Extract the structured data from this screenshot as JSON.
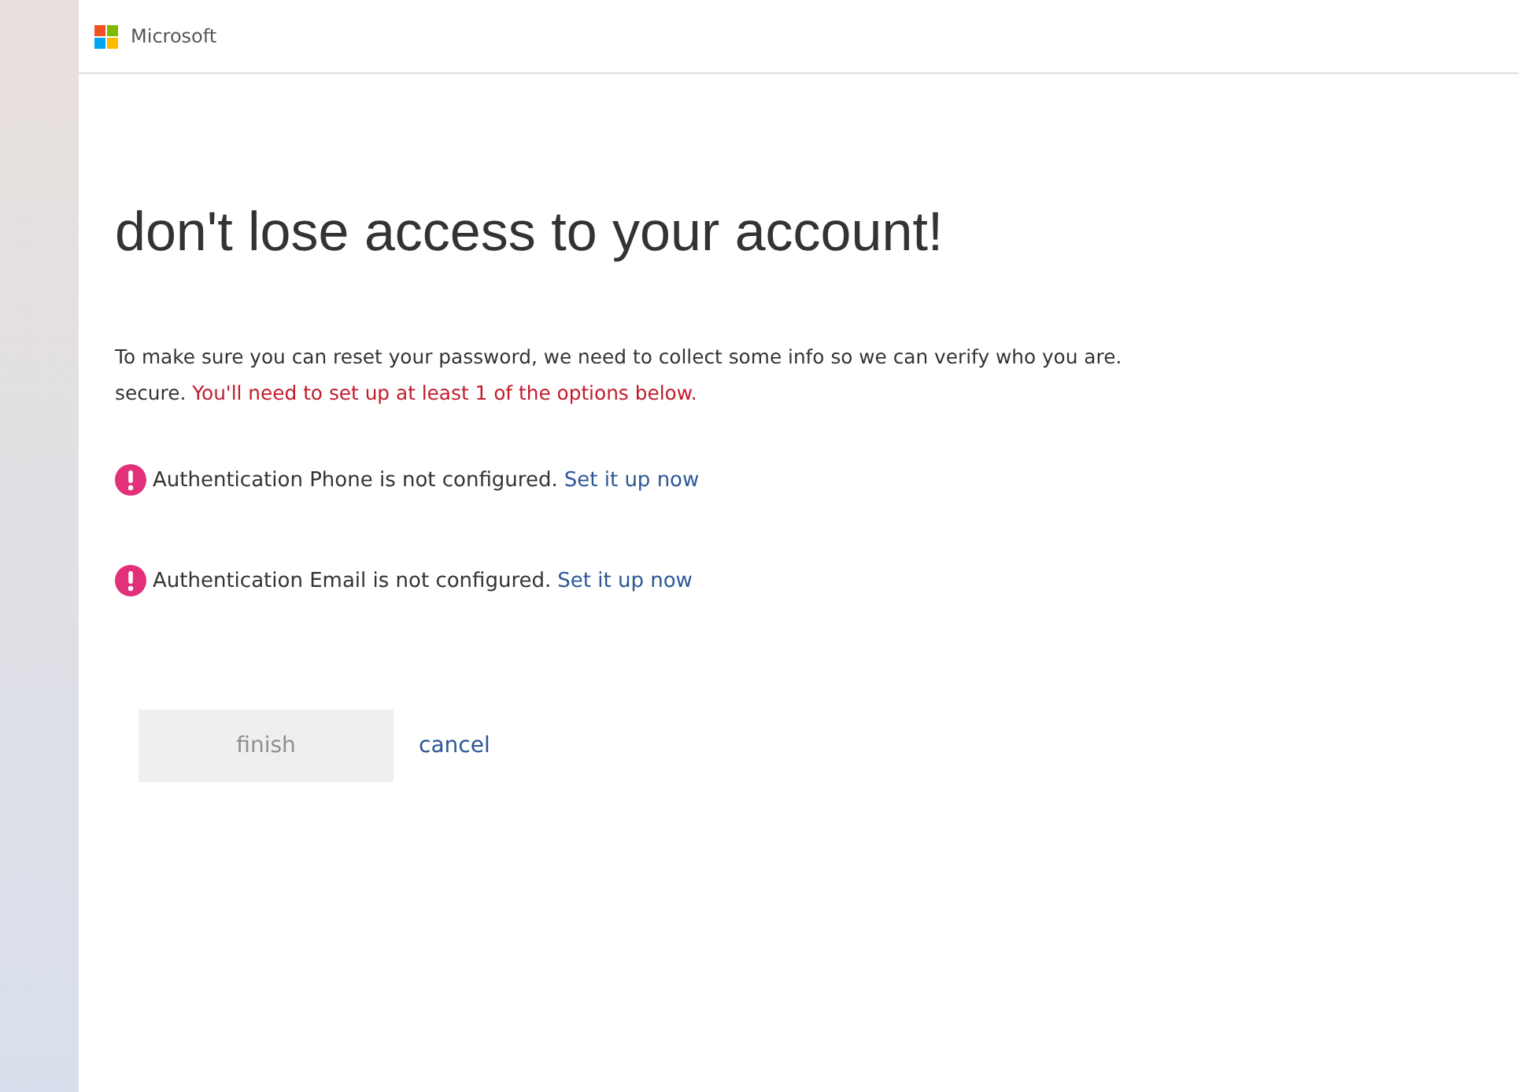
{
  "header": {
    "brand": "Microsoft"
  },
  "title": "don't lose access to your account!",
  "intro": {
    "lines": [
      "To make sure you can reset your password, we need to collect some info so we can verify who you are.",
      "secure."
    ],
    "warning": "You'll need to set up at least 1 of the options below."
  },
  "methods": [
    {
      "text": "Authentication Phone is not configured.",
      "configured": false,
      "link": "Set it up now"
    },
    {
      "text": "Authentication Email is not configured.",
      "configured": false,
      "link": "Set it up now"
    }
  ],
  "buttons": {
    "finish": {
      "label": "finish",
      "disabled": true
    },
    "cancel": {
      "label": "cancel"
    }
  }
}
